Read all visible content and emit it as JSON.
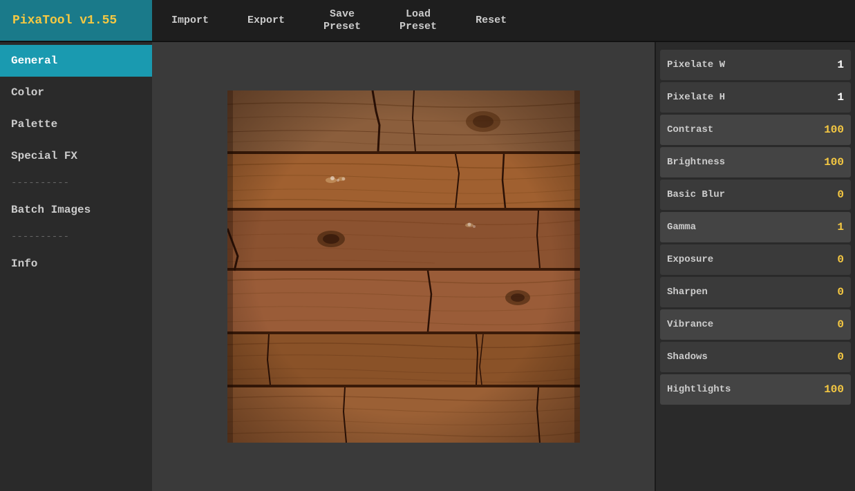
{
  "app": {
    "title": "PixaTool v1.55"
  },
  "nav": {
    "import_label": "Import",
    "export_label": "Export",
    "save_preset_label": "Save\nPreset",
    "load_preset_label": "Load\nPreset",
    "reset_label": "Reset"
  },
  "sidebar": {
    "items": [
      {
        "id": "general",
        "label": "General",
        "active": true
      },
      {
        "id": "color",
        "label": "Color",
        "active": false
      },
      {
        "id": "palette",
        "label": "Palette",
        "active": false
      },
      {
        "id": "special-fx",
        "label": "Special FX",
        "active": false
      }
    ],
    "divider1": "----------",
    "batch_images_label": "Batch Images",
    "divider2": "----------",
    "info_label": "Info"
  },
  "controls": [
    {
      "id": "pixelate-w",
      "label": "Pixelate W",
      "value": "1",
      "value_color": "white",
      "highlighted": false
    },
    {
      "id": "pixelate-h",
      "label": "Pixelate H",
      "value": "1",
      "value_color": "white",
      "highlighted": false
    },
    {
      "id": "contrast",
      "label": "Contrast",
      "value": "100",
      "value_color": "yellow",
      "highlighted": true
    },
    {
      "id": "brightness",
      "label": "Brightness",
      "value": "100",
      "value_color": "yellow",
      "highlighted": true
    },
    {
      "id": "basic-blur",
      "label": "Basic Blur",
      "value": "0",
      "value_color": "yellow",
      "highlighted": false
    },
    {
      "id": "gamma",
      "label": "Gamma",
      "value": "1",
      "value_color": "yellow",
      "highlighted": true
    },
    {
      "id": "exposure",
      "label": "Exposure",
      "value": "0",
      "value_color": "yellow",
      "highlighted": false
    },
    {
      "id": "sharpen",
      "label": "Sharpen",
      "value": "0",
      "value_color": "yellow",
      "highlighted": false
    },
    {
      "id": "vibrance",
      "label": "Vibrance",
      "value": "0",
      "value_color": "yellow",
      "highlighted": true
    },
    {
      "id": "shadows",
      "label": "Shadows",
      "value": "0",
      "value_color": "yellow",
      "highlighted": false
    },
    {
      "id": "highlights",
      "label": "Hightlights",
      "value": "100",
      "value_color": "yellow",
      "highlighted": true
    }
  ]
}
